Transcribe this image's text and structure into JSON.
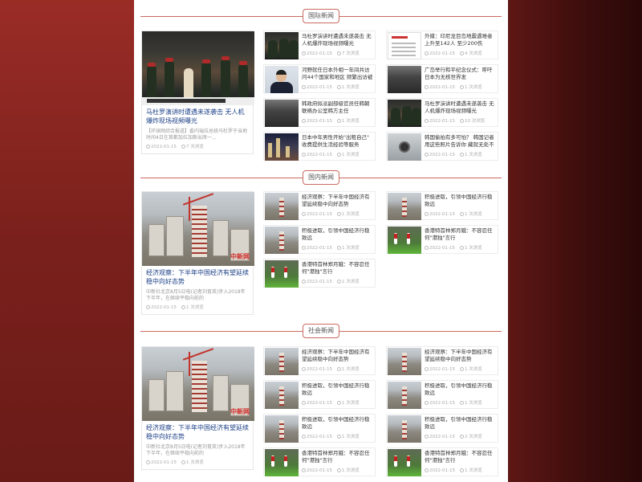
{
  "sections": [
    {
      "title": "国际新闻",
      "featured": {
        "title": "马杜罗演讲时遭遇未遂袭击 无人机爆炸现场视频曝光",
        "desc": "【环球网综合报道】委内瑞拉总统马杜罗于当地时间4日在首都加拉加斯出席一...",
        "date": "2022-01-15",
        "views": "7 次浏览",
        "image": "parade-photo"
      },
      "items": [
        {
          "title": "马杜罗演讲时遭遇未遂袭击 无人机爆炸现场视频曝光",
          "date": "2022-01-15",
          "views": "7 次浏览",
          "image": "parade-photo"
        },
        {
          "title": "外媒：印尼龙目岛地震遇难者上升至142人 至少200伤",
          "date": "2022-01-15",
          "views": "4 次浏览",
          "image": "document-photo"
        },
        {
          "title": "河野就任日本外相一年间共访问44个国家和地区 频繁出访被",
          "date": "2022-01-15",
          "views": "1 次浏览",
          "image": "man-photo"
        },
        {
          "title": "广岛举行和平纪念仪式：呼吁日本为无核世界发",
          "date": "2022-01-15",
          "views": "1 次浏览",
          "image": "dark-photo"
        },
        {
          "title": "韩政府拟派副部级官员任韩朝联络办公室韩方主任",
          "date": "2022-01-15",
          "views": "1 次浏览",
          "image": "dark-photo"
        },
        {
          "title": "马杜罗演讲时遭遇未遂袭击 无人机爆炸现场视频曝光",
          "date": "2022-01-15",
          "views": "10 次浏览",
          "image": "parade-photo"
        },
        {
          "title": "日本中年男性开始\"出租自己\" 收费提供生活经验等服务",
          "date": "2022-01-15",
          "views": "1 次浏览",
          "image": "night-photo"
        },
        {
          "title": "韩国偷拍有多可怕？ 韩国记者用这些照片告诉你 藏就无处不",
          "date": "2022-01-15",
          "views": "1 次浏览",
          "image": "camera-photo"
        }
      ]
    },
    {
      "title": "国内新闻",
      "featured": {
        "title": "经济观察：下半年中国经济有望延续稳中向好态势",
        "desc": "中新社北京8月5日电(记者刘育英)步入2018年下半年，在继续平稳向前的",
        "date": "2022-01-15",
        "views": "1 次浏览",
        "image": "city-photo"
      },
      "items": [
        {
          "title": "经济观察：下半年中国经济有望延续稳中向好态势",
          "date": "2022-01-15",
          "views": "1 次浏览",
          "image": "city-photo"
        },
        {
          "title": "积极进取，引领中国经济行稳致远",
          "date": "2022-01-15",
          "views": "1 次浏览",
          "image": "city-photo"
        },
        {
          "title": "积极进取，引领中国经济行稳致远",
          "date": "2022-01-15",
          "views": "1 次浏览",
          "image": "city-photo"
        },
        {
          "title": "香港特首林郑月娥：不容忍任何\"港独\"言行",
          "date": "2022-01-15",
          "views": "1 次浏览",
          "image": "green-photo"
        },
        {
          "title": "香港特首林郑月娥：不容忍任何\"港独\"言行",
          "date": "2022-01-15",
          "views": "1 次浏览",
          "image": "green-photo"
        }
      ]
    },
    {
      "title": "社会新闻",
      "featured": {
        "title": "经济观察：下半年中国经济有望延续稳中向好态势",
        "desc": "中新社北京8月5日电(记者刘育英)步入2018年下半年，在继续平稳向前的",
        "date": "2022-01-15",
        "views": "1 次浏览",
        "image": "city-photo"
      },
      "items": [
        {
          "title": "经济观察：下半年中国经济有望延续稳中向好态势",
          "date": "2022-01-15",
          "views": "1 次浏览",
          "image": "city-photo"
        },
        {
          "title": "经济观察：下半年中国经济有望延续稳中向好态势",
          "date": "2022-01-15",
          "views": "1 次浏览",
          "image": "city-photo"
        },
        {
          "title": "积极进取，引领中国经济行稳致远",
          "date": "2022-01-15",
          "views": "1 次浏览",
          "image": "city-photo"
        },
        {
          "title": "积极进取，引领中国经济行稳致远",
          "date": "2022-01-15",
          "views": "1 次浏览",
          "image": "city-photo"
        },
        {
          "title": "积极进取，引领中国经济行稳致远",
          "date": "2022-01-15",
          "views": "1 次浏览",
          "image": "city-photo"
        },
        {
          "title": "积极进取，引领中国经济行稳致远",
          "date": "2022-01-15",
          "views": "2 次浏览",
          "image": "city-photo"
        },
        {
          "title": "香港特首林郑月娥：不容忍任何\"港独\"言行",
          "date": "2022-01-15",
          "views": "1 次浏览",
          "image": "green-photo"
        },
        {
          "title": "香港特首林郑月娥：不容忍任何\"港独\"言行",
          "date": "2022-01-15",
          "views": "1 次浏览",
          "image": "green-photo"
        }
      ]
    }
  ],
  "colors": {
    "accent": "#c96a5f",
    "title_blue": "#1b3f86",
    "meta": "#aaaaaa"
  },
  "icons": {
    "date": "clock-icon",
    "views": "eye-icon"
  }
}
